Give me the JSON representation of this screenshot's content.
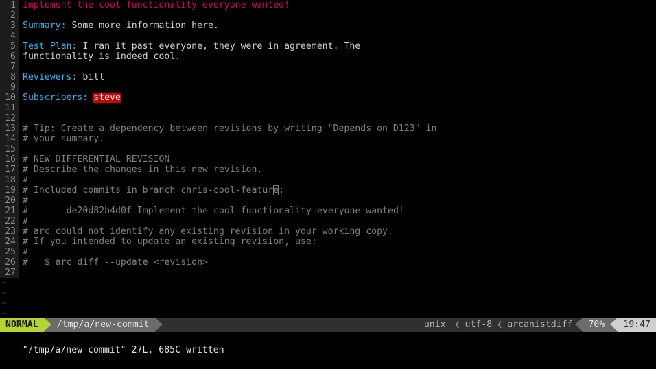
{
  "editor": {
    "app": "vim",
    "gutter_numbers": [
      "1",
      "2",
      "3",
      "4",
      "5",
      "6",
      "7",
      "8",
      "9",
      "10",
      "11",
      "12",
      "13",
      "14",
      "15",
      "16",
      "17",
      "18",
      "19",
      "20",
      "21",
      "22",
      "23",
      "24",
      "25",
      "26",
      "27"
    ],
    "lines": [
      {
        "n": "1",
        "segments": [
          {
            "text": "Implement the cool functionality everyone wanted!",
            "style": "title"
          }
        ]
      },
      {
        "n": "2",
        "segments": [
          {
            "text": "",
            "style": "text"
          }
        ]
      },
      {
        "n": "3",
        "segments": [
          {
            "text": "Summary:",
            "style": "field"
          },
          {
            "text": " Some more information here.",
            "style": "text"
          }
        ]
      },
      {
        "n": "4",
        "segments": [
          {
            "text": "",
            "style": "text"
          }
        ]
      },
      {
        "n": "5",
        "segments": [
          {
            "text": "Test Plan:",
            "style": "field"
          },
          {
            "text": " I ran it past everyone, they were in agreement. The",
            "style": "text"
          }
        ]
      },
      {
        "n": "6",
        "segments": [
          {
            "text": "functionality is indeed cool.",
            "style": "text"
          }
        ]
      },
      {
        "n": "7",
        "segments": [
          {
            "text": "",
            "style": "text"
          }
        ]
      },
      {
        "n": "8",
        "segments": [
          {
            "text": "Reviewers:",
            "style": "field"
          },
          {
            "text": " bill",
            "style": "text"
          }
        ]
      },
      {
        "n": "9",
        "segments": [
          {
            "text": "",
            "style": "text"
          }
        ]
      },
      {
        "n": "10",
        "segments": [
          {
            "text": "Subscribers:",
            "style": "field"
          },
          {
            "text": " ",
            "style": "text"
          },
          {
            "text": "steve",
            "style": "highlight"
          }
        ]
      },
      {
        "n": "11",
        "segments": [
          {
            "text": "",
            "style": "text"
          }
        ]
      },
      {
        "n": "12",
        "segments": [
          {
            "text": "",
            "style": "text"
          }
        ]
      },
      {
        "n": "13",
        "segments": [
          {
            "text": "# Tip: Create a dependency between revisions by writing \"Depends on D123\" in",
            "style": "comment"
          }
        ]
      },
      {
        "n": "14",
        "segments": [
          {
            "text": "# your summary.",
            "style": "comment"
          }
        ]
      },
      {
        "n": "15",
        "segments": [
          {
            "text": "",
            "style": "text"
          }
        ]
      },
      {
        "n": "16",
        "segments": [
          {
            "text": "# NEW DIFFERENTIAL REVISION",
            "style": "comment"
          }
        ]
      },
      {
        "n": "17",
        "segments": [
          {
            "text": "# Describe the changes in this new revision.",
            "style": "comment"
          }
        ]
      },
      {
        "n": "18",
        "segments": [
          {
            "text": "#",
            "style": "comment"
          },
          {
            "text": " ",
            "style": "trailing-whitespace"
          }
        ]
      },
      {
        "n": "19",
        "segments": [
          {
            "text": "# Included commits in branch chris-cool-featur",
            "style": "comment"
          },
          {
            "text": "e",
            "style": "cursor"
          },
          {
            "text": ":",
            "style": "comment"
          }
        ]
      },
      {
        "n": "20",
        "segments": [
          {
            "text": "#",
            "style": "comment"
          },
          {
            "text": " ",
            "style": "trailing-whitespace"
          }
        ]
      },
      {
        "n": "21",
        "segments": [
          {
            "text": "#",
            "style": "comment"
          },
          {
            "text": " ",
            "style": "trailing-whitespace"
          },
          {
            "text": "      de20d82b4d0f Implement the cool functionality everyone wanted!",
            "style": "comment"
          }
        ]
      },
      {
        "n": "22",
        "segments": [
          {
            "text": "#",
            "style": "comment"
          },
          {
            "text": " ",
            "style": "trailing-whitespace"
          }
        ]
      },
      {
        "n": "23",
        "segments": [
          {
            "text": "# arc could not identify any existing revision in your working copy.",
            "style": "comment"
          }
        ]
      },
      {
        "n": "24",
        "segments": [
          {
            "text": "# If you intended to update an existing revision, use:",
            "style": "comment"
          }
        ]
      },
      {
        "n": "25",
        "segments": [
          {
            "text": "#",
            "style": "comment"
          },
          {
            "text": " ",
            "style": "trailing-whitespace"
          }
        ]
      },
      {
        "n": "26",
        "segments": [
          {
            "text": "#   $ arc diff --update <revision>",
            "style": "comment"
          }
        ]
      },
      {
        "n": "27",
        "segments": [
          {
            "text": "",
            "style": "text"
          }
        ]
      }
    ],
    "filler_marker": "~",
    "filler_count": 4
  },
  "statusline": {
    "mode": "NORMAL",
    "filename": "/tmp/a/new-commit",
    "fileformat": "unix",
    "encoding": "utf-8",
    "filetype": "arcanistdiff",
    "percent": "70%",
    "time": "19:47",
    "thin_separator": "❮"
  },
  "cmdline": {
    "message": "\"/tmp/a/new-commit\" 27L, 685C written"
  },
  "colors": {
    "background": "#000000",
    "gutter_bg": "#1c1c1c",
    "gutter_fg": "#8a8a8a",
    "title": "#d7005f",
    "field": "#35b5e8",
    "text": "#d0d0d0",
    "comment": "#808080",
    "highlight_bg": "#cc0000",
    "trailing_whitespace_bg": "#5f0000",
    "mode_bg": "#b1d631",
    "file_bg": "#6b6b6b",
    "status_bg": "#303030",
    "time_bg": "#d0d0d0"
  }
}
